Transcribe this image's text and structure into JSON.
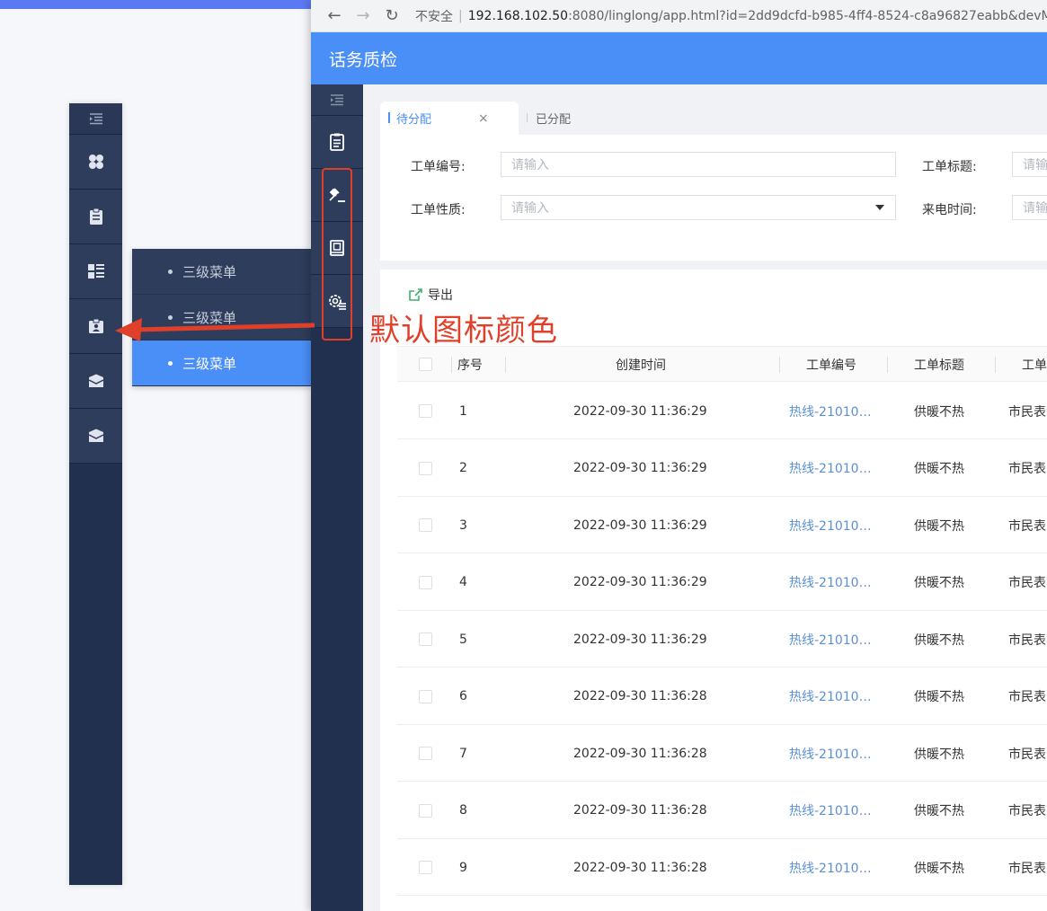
{
  "colors": {
    "sidebar_dark": "#223050",
    "sidebar_item": "#2f3d5c",
    "brand_blue": "#4a8ff7",
    "annotation_red": "#e0402a"
  },
  "left_sidebar": {
    "icons": [
      "menu-collapse-icon",
      "grid-icon",
      "clipboard-icon",
      "list-icon",
      "id-badge-icon",
      "envelope-icon",
      "envelope-icon"
    ]
  },
  "submenu": {
    "items": [
      {
        "label": "三级菜单"
      },
      {
        "label": "三级菜单"
      },
      {
        "label": "三级菜单"
      }
    ],
    "active_index": 2
  },
  "browser": {
    "insecure_label": "不安全",
    "url_host": "192.168.102.50",
    "url_path": ":8080/linglong/app.html?id=2dd9dcfd-b985-4ff4-8524-c8a96827eabb&devM"
  },
  "app": {
    "title": "话务质检",
    "sidebar_icons": [
      "menu-collapse-icon",
      "document-icon",
      "gavel-icon",
      "book-icon",
      "settings-list-icon"
    ]
  },
  "tabs": [
    {
      "label": "待分配",
      "active": true,
      "close": "×"
    },
    {
      "label": "已分配",
      "active": false
    }
  ],
  "filters": {
    "order_no_label": "工单编号:",
    "order_no_placeholder": "请输入",
    "order_title_label": "工单标题:",
    "order_title_placeholder": "请输",
    "order_type_label": "工单性质:",
    "order_type_placeholder": "请输入",
    "call_time_label": "来电时间:",
    "call_time_placeholder": "请输"
  },
  "toolbar": {
    "export_label": "导出"
  },
  "table": {
    "headers": [
      "序号",
      "创建时间",
      "工单编号",
      "工单标题",
      "工单"
    ],
    "rows": [
      {
        "index": "1",
        "created": "2022-09-30 11:36:29",
        "order_no": "热线-21010…",
        "title": "供暖不热",
        "type": "市民表"
      },
      {
        "index": "2",
        "created": "2022-09-30 11:36:29",
        "order_no": "热线-21010…",
        "title": "供暖不热",
        "type": "市民表"
      },
      {
        "index": "3",
        "created": "2022-09-30 11:36:29",
        "order_no": "热线-21010…",
        "title": "供暖不热",
        "type": "市民表"
      },
      {
        "index": "4",
        "created": "2022-09-30 11:36:29",
        "order_no": "热线-21010…",
        "title": "供暖不热",
        "type": "市民表"
      },
      {
        "index": "5",
        "created": "2022-09-30 11:36:29",
        "order_no": "热线-21010…",
        "title": "供暖不热",
        "type": "市民表"
      },
      {
        "index": "6",
        "created": "2022-09-30 11:36:28",
        "order_no": "热线-21010…",
        "title": "供暖不热",
        "type": "市民表"
      },
      {
        "index": "7",
        "created": "2022-09-30 11:36:28",
        "order_no": "热线-21010…",
        "title": "供暖不热",
        "type": "市民表"
      },
      {
        "index": "8",
        "created": "2022-09-30 11:36:28",
        "order_no": "热线-21010…",
        "title": "供暖不热",
        "type": "市民表"
      },
      {
        "index": "9",
        "created": "2022-09-30 11:36:28",
        "order_no": "热线-21010…",
        "title": "供暖不热",
        "type": "市民表"
      }
    ]
  },
  "annotation": {
    "text": "默认图标颜色"
  }
}
